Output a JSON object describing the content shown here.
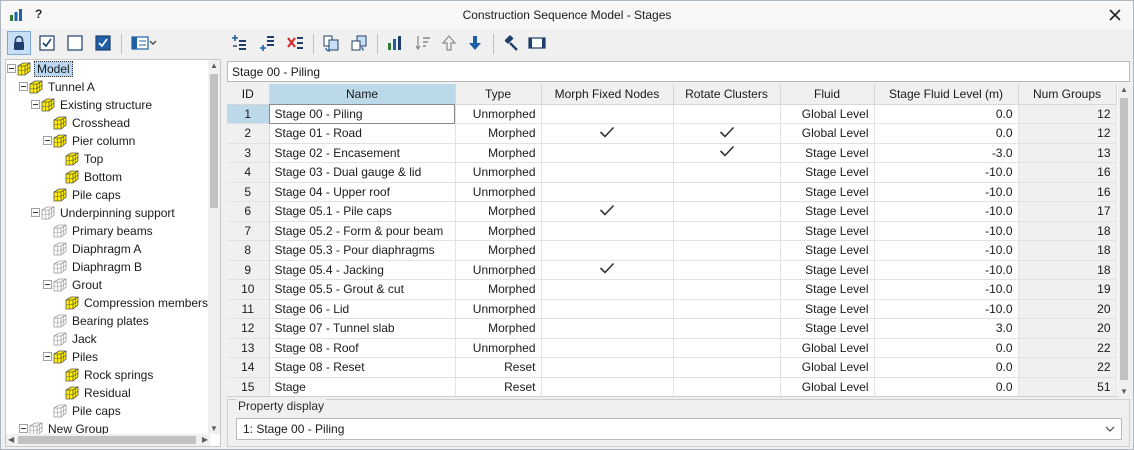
{
  "window": {
    "title": "Construction Sequence Model - Stages",
    "help_label": "?",
    "app_icon": "bar-chart-icon",
    "close_icon": "close-icon"
  },
  "left_toolbar": {
    "icons": [
      "lock-icon",
      "checked-box-icon",
      "unchecked-box-icon",
      "checked-box-filled-icon",
      "layout-dropdown-icon"
    ]
  },
  "tree": {
    "items": [
      {
        "label": "Model"
      },
      {
        "label": "Tunnel A"
      },
      {
        "label": "Existing structure"
      },
      {
        "label": "Crosshead"
      },
      {
        "label": "Pier column"
      },
      {
        "label": "Top"
      },
      {
        "label": "Bottom"
      },
      {
        "label": "Pile caps"
      },
      {
        "label": "Underpinning support"
      },
      {
        "label": "Primary beams"
      },
      {
        "label": "Diaphragm A"
      },
      {
        "label": "Diaphragm B"
      },
      {
        "label": "Grout"
      },
      {
        "label": "Compression members"
      },
      {
        "label": "Bearing plates"
      },
      {
        "label": "Jack"
      },
      {
        "label": "Piles"
      },
      {
        "label": "Rock springs"
      },
      {
        "label": "Residual"
      },
      {
        "label": "Pile caps"
      },
      {
        "label": "New Group"
      }
    ]
  },
  "right_toolbar": {
    "icons": [
      "insert-stage-above-icon",
      "insert-stage-below-icon",
      "delete-stage-icon",
      "copy-stage-icon",
      "paste-stage-icon",
      "chart-icon",
      "sort-icon",
      "move-up-icon",
      "move-down-icon",
      "hammer-icon",
      "film-icon"
    ]
  },
  "stage_name_field": {
    "value": "Stage 00 - Piling"
  },
  "grid": {
    "columns": [
      "ID",
      "Name",
      "Type",
      "Morph Fixed Nodes",
      "Rotate Clusters",
      "Fluid",
      "Stage Fluid Level (m)",
      "Num Groups"
    ],
    "rows": [
      {
        "id": "1",
        "name": "Stage 00 - Piling",
        "type": "Unmorphed",
        "morph": false,
        "rotate": false,
        "fluid": "Global Level",
        "level": "0.0",
        "groups": "12"
      },
      {
        "id": "2",
        "name": "Stage 01 - Road",
        "type": "Morphed",
        "morph": true,
        "rotate": true,
        "fluid": "Global Level",
        "level": "0.0",
        "groups": "12"
      },
      {
        "id": "3",
        "name": "Stage 02 - Encasement",
        "type": "Morphed",
        "morph": false,
        "rotate": true,
        "fluid": "Stage Level",
        "level": "-3.0",
        "groups": "13"
      },
      {
        "id": "4",
        "name": "Stage 03 - Dual gauge & lid",
        "type": "Unmorphed",
        "morph": false,
        "rotate": false,
        "fluid": "Stage Level",
        "level": "-10.0",
        "groups": "16"
      },
      {
        "id": "5",
        "name": "Stage 04 - Upper roof",
        "type": "Unmorphed",
        "morph": false,
        "rotate": false,
        "fluid": "Stage Level",
        "level": "-10.0",
        "groups": "16"
      },
      {
        "id": "6",
        "name": "Stage 05.1 - Pile caps",
        "type": "Morphed",
        "morph": true,
        "rotate": false,
        "fluid": "Stage Level",
        "level": "-10.0",
        "groups": "17"
      },
      {
        "id": "7",
        "name": "Stage 05.2 - Form & pour beam",
        "type": "Morphed",
        "morph": false,
        "rotate": false,
        "fluid": "Stage Level",
        "level": "-10.0",
        "groups": "18"
      },
      {
        "id": "8",
        "name": "Stage 05.3 - Pour diaphragms",
        "type": "Morphed",
        "morph": false,
        "rotate": false,
        "fluid": "Stage Level",
        "level": "-10.0",
        "groups": "18"
      },
      {
        "id": "9",
        "name": "Stage 05.4 - Jacking",
        "type": "Unmorphed",
        "morph": true,
        "rotate": false,
        "fluid": "Stage Level",
        "level": "-10.0",
        "groups": "18"
      },
      {
        "id": "10",
        "name": "Stage 05.5 - Grout & cut",
        "type": "Morphed",
        "morph": false,
        "rotate": false,
        "fluid": "Stage Level",
        "level": "-10.0",
        "groups": "19"
      },
      {
        "id": "11",
        "name": "Stage 06 - Lid",
        "type": "Unmorphed",
        "morph": false,
        "rotate": false,
        "fluid": "Stage Level",
        "level": "-10.0",
        "groups": "20"
      },
      {
        "id": "12",
        "name": "Stage 07 - Tunnel slab",
        "type": "Morphed",
        "morph": false,
        "rotate": false,
        "fluid": "Stage Level",
        "level": "3.0",
        "groups": "20"
      },
      {
        "id": "13",
        "name": "Stage 08 - Roof",
        "type": "Unmorphed",
        "morph": false,
        "rotate": false,
        "fluid": "Global Level",
        "level": "0.0",
        "groups": "22"
      },
      {
        "id": "14",
        "name": "Stage 08 - Reset",
        "type": "Reset",
        "morph": false,
        "rotate": false,
        "fluid": "Global Level",
        "level": "0.0",
        "groups": "22"
      },
      {
        "id": "15",
        "name": "Stage",
        "type": "Reset",
        "morph": false,
        "rotate": false,
        "fluid": "Global Level",
        "level": "0.0",
        "groups": "51"
      }
    ],
    "current_row": "1"
  },
  "property_display": {
    "legend": "Property display",
    "selected": "1: Stage 00 - Piling"
  },
  "colors": {
    "accent": "#1f5fa8",
    "selection": "#bcd9ea",
    "cube_yellow": "#ffee00"
  }
}
